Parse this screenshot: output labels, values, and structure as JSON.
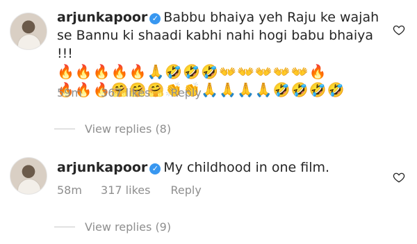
{
  "comments": [
    {
      "username": "arjunkapoor",
      "text": "Babbu bhaiya yeh Raju ke wajah se Bannu ki shaadi kabhi nahi hogi babu bhaiya !!!",
      "emoji_line_1": "🔥🔥🔥🔥🔥🙏🤣🤣🤣👐👐👐👐👐🔥",
      "emoji_line_2": "🔥🔥🔥🤗🤗🤗👏👏🙏🙏🙏🙏🤣🤣🤣🤣",
      "time": "59m",
      "likes": "367 likes",
      "reply_label": "Reply",
      "view_replies": "View replies (8)"
    },
    {
      "username": "arjunkapoor",
      "text": "My childhood in one film.",
      "time": "58m",
      "likes": "317 likes",
      "reply_label": "Reply",
      "view_replies": "View replies (9)"
    }
  ],
  "icons": {
    "verified": "verified-badge-icon",
    "like": "heart-icon"
  },
  "colors": {
    "verified": "#3897f0",
    "meta": "#8e8e8e",
    "text": "#262626"
  }
}
